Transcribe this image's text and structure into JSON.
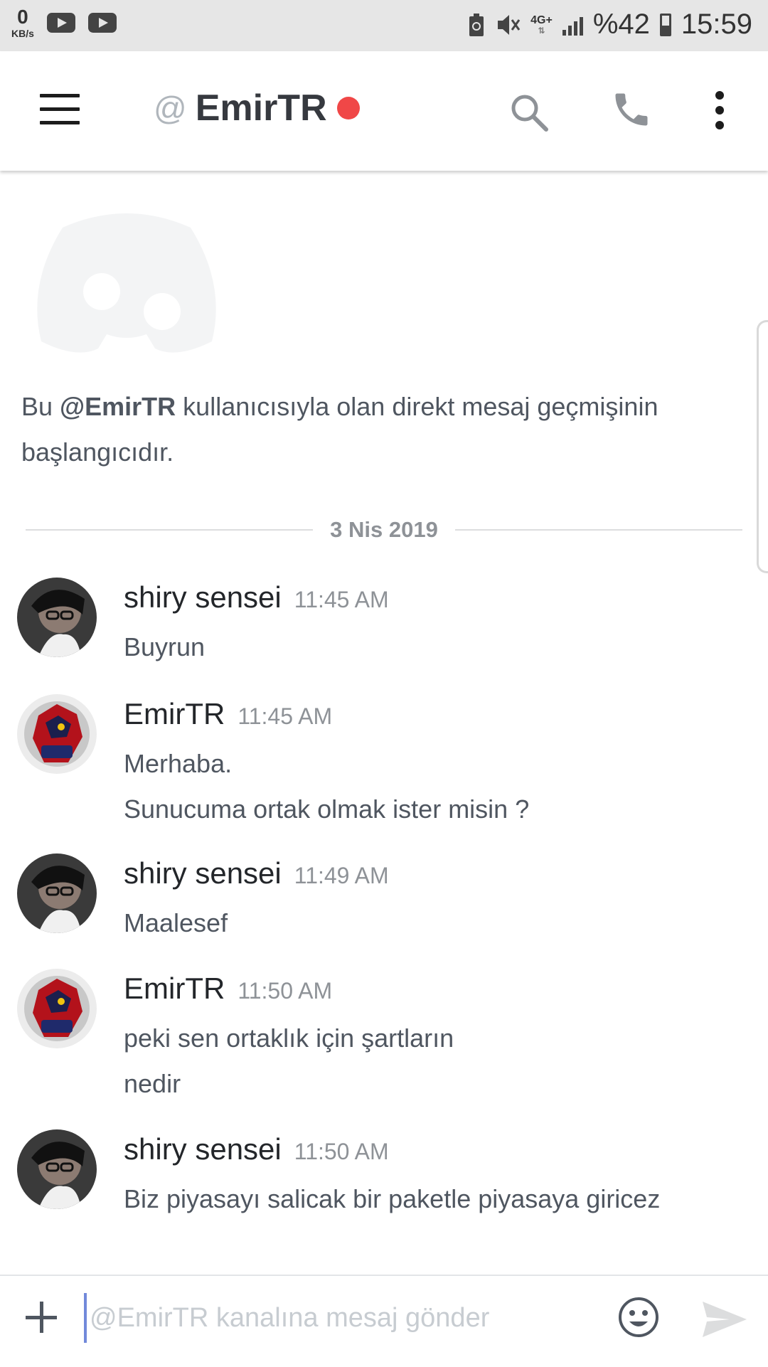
{
  "status_bar": {
    "speed_value": "0",
    "speed_unit": "KB/s",
    "network": "4G+",
    "battery": "%42",
    "time": "15:59"
  },
  "header": {
    "at_symbol": "@",
    "title": "EmirTR",
    "status_color": "#f04747"
  },
  "intro": {
    "prefix": "Bu ",
    "mention": "@EmirTR",
    "suffix": " kullanıcısıyla olan direkt mesaj geçmişinin başlangıcıdır."
  },
  "date_divider": "3 Nis 2019",
  "messages": [
    {
      "author": "shiry sensei",
      "time": "11:45 AM",
      "lines": [
        "Buyrun"
      ],
      "avatar": "shiry-avatar"
    },
    {
      "author": "EmirTR",
      "time": "11:45 AM",
      "lines": [
        "Merhaba.",
        "Sunucuma ortak olmak ister misin ?"
      ],
      "avatar": "emir-avatar"
    },
    {
      "author": "shiry sensei",
      "time": "11:49 AM",
      "lines": [
        "Maalesef"
      ],
      "avatar": "shiry-avatar"
    },
    {
      "author": "EmirTR",
      "time": "11:50 AM",
      "lines": [
        "peki sen ortaklık için şartların",
        "nedir"
      ],
      "avatar": "emir-avatar"
    },
    {
      "author": "shiry sensei",
      "time": "11:50 AM",
      "lines": [
        "Biz piyasayı salicak bir paketle piyasaya giricez"
      ],
      "avatar": "shiry-avatar"
    }
  ],
  "composer": {
    "placeholder": "@EmirTR kanalına mesaj gönder",
    "value": ""
  },
  "colors": {
    "accent": "#7289da",
    "online": "#f04747",
    "muted": "#8e9297"
  }
}
